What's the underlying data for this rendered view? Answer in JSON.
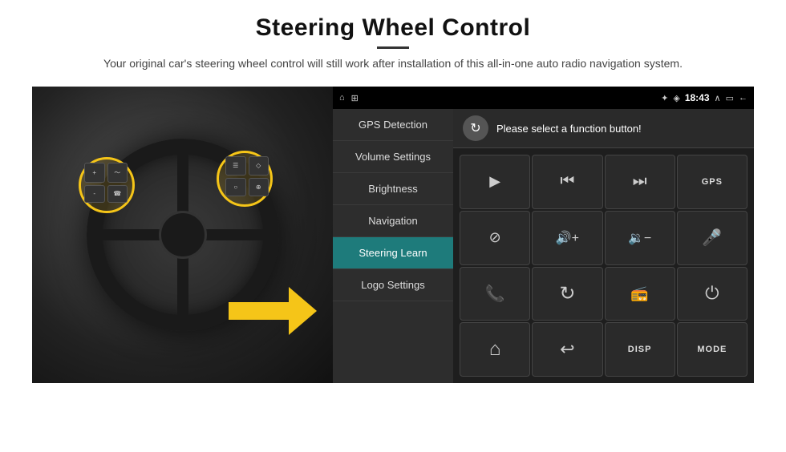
{
  "page": {
    "title": "Steering Wheel Control",
    "divider": "—",
    "subtitle": "Your original car's steering wheel control will still work after installation of this all-in-one auto radio navigation system."
  },
  "status_bar": {
    "time": "18:43",
    "icons": [
      "home",
      "app",
      "bluetooth",
      "wifi",
      "chevron-up",
      "window",
      "back"
    ]
  },
  "menu": {
    "items": [
      {
        "id": "gps-detection",
        "label": "GPS Detection",
        "active": false
      },
      {
        "id": "volume-settings",
        "label": "Volume Settings",
        "active": false
      },
      {
        "id": "brightness",
        "label": "Brightness",
        "active": false
      },
      {
        "id": "navigation",
        "label": "Navigation",
        "active": false
      },
      {
        "id": "steering-learn",
        "label": "Steering Learn",
        "active": true
      },
      {
        "id": "logo-settings",
        "label": "Logo Settings",
        "active": false
      }
    ]
  },
  "panel": {
    "header_text": "Please select a function button!",
    "refresh_icon": "↻",
    "buttons": [
      {
        "id": "play",
        "icon": "play",
        "label": ""
      },
      {
        "id": "prev",
        "icon": "prev",
        "label": ""
      },
      {
        "id": "next",
        "icon": "next",
        "label": ""
      },
      {
        "id": "gps",
        "icon": "gps",
        "label": "GPS"
      },
      {
        "id": "mute",
        "icon": "mute",
        "label": ""
      },
      {
        "id": "vol-up",
        "icon": "volup",
        "label": ""
      },
      {
        "id": "vol-down",
        "icon": "voldown",
        "label": ""
      },
      {
        "id": "mic",
        "icon": "mic",
        "label": ""
      },
      {
        "id": "phone",
        "icon": "phone",
        "label": ""
      },
      {
        "id": "rotate",
        "icon": "rotate",
        "label": ""
      },
      {
        "id": "radio",
        "icon": "radio",
        "label": ""
      },
      {
        "id": "power",
        "icon": "power",
        "label": ""
      },
      {
        "id": "home",
        "icon": "home",
        "label": ""
      },
      {
        "id": "back",
        "icon": "back",
        "label": ""
      },
      {
        "id": "disp",
        "icon": "disp",
        "label": "DISP"
      },
      {
        "id": "mode",
        "icon": "mode",
        "label": "MODE"
      }
    ]
  }
}
